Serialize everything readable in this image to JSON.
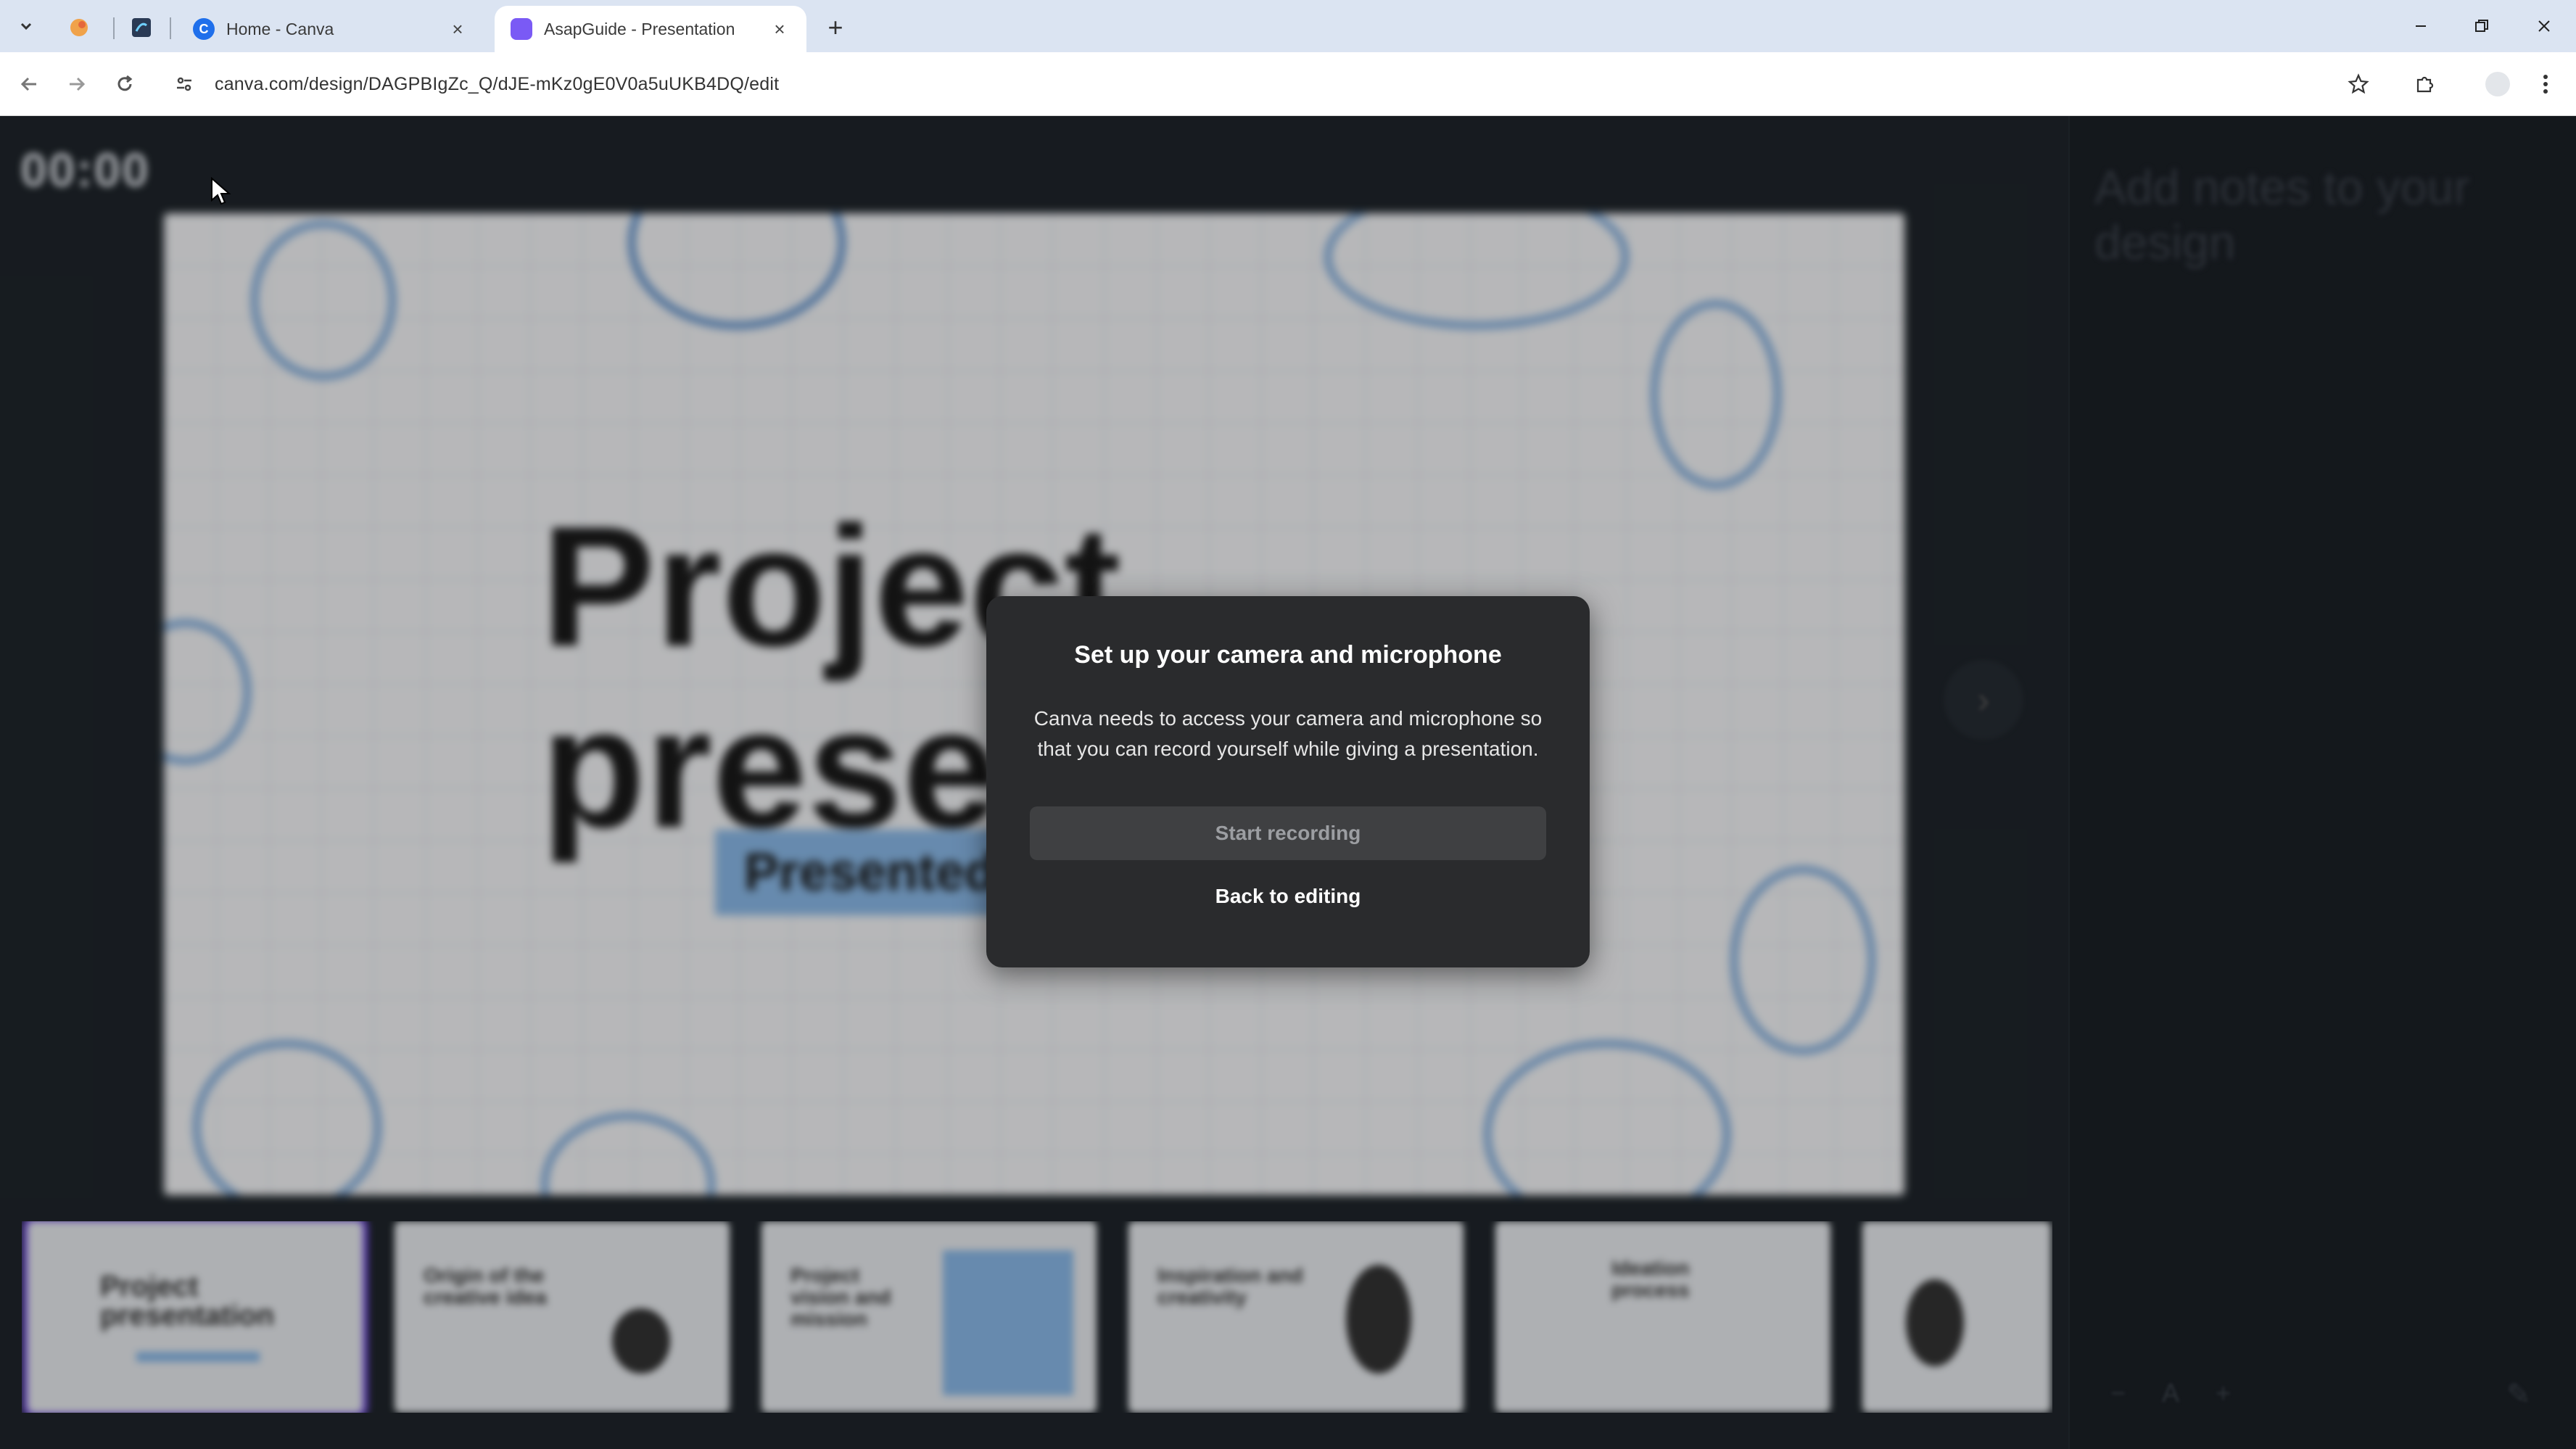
{
  "browser": {
    "tabs": [
      {
        "title": "Home - Canva",
        "favicon_color": "#1f6feb"
      },
      {
        "title": "AsapGuide - Presentation",
        "favicon_color": "#7a5af5"
      }
    ],
    "url": "canva.com/design/DAGPBIgZc_Q/dJE-mKz0gE0V0a5uUKB4DQ/edit"
  },
  "presenter": {
    "timer": "00:00",
    "notes_placeholder": "Add notes to your design",
    "slide": {
      "title": "Project presentation",
      "subtitle": "Presented by"
    },
    "thumbnails": [
      {
        "title": "Project presentation"
      },
      {
        "title": "Origin of the creative idea"
      },
      {
        "title": "Project vision and mission"
      },
      {
        "title": "Inspiration and creativity"
      },
      {
        "title": "Ideation process"
      },
      {
        "title": ""
      }
    ]
  },
  "modal": {
    "title": "Set up your camera and microphone",
    "body": "Canva needs to access your camera and microphone so that you can record yourself while giving a presentation.",
    "start_button": "Start recording",
    "back_button": "Back to editing"
  }
}
